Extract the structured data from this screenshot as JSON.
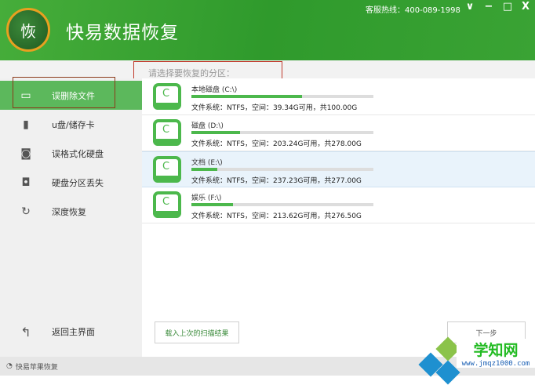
{
  "header": {
    "logo_char": "恢",
    "title": "快易数据恢复",
    "hotline": "客服热线：400-089-1998",
    "controls": {
      "dropdown": "∨",
      "minimize": "−",
      "maximize": "□",
      "close": "X"
    }
  },
  "prompt": "请选择要恢复的分区：",
  "sidebar": {
    "items": [
      {
        "label": "误删除文件",
        "icon": "folder-icon"
      },
      {
        "label": "u盘/储存卡",
        "icon": "usb-icon"
      },
      {
        "label": "误格式化硬盘",
        "icon": "hard-disk-icon"
      },
      {
        "label": "硬盘分区丢失",
        "icon": "partition-icon"
      },
      {
        "label": "深度恢复",
        "icon": "deep-scan-icon"
      }
    ],
    "back_label": "返回主界面"
  },
  "partitions": [
    {
      "name": "本地磁盘 (C:\\)",
      "info": "文件系统：NTFS，空间：39.34G可用，共100.00G",
      "used_pct": 60.7
    },
    {
      "name": "磁盘 (D:\\)",
      "info": "文件系统：NTFS，空间：203.24G可用，共278.00G",
      "used_pct": 26.9
    },
    {
      "name": "文档 (E:\\)",
      "info": "文件系统：NTFS，空间：237.23G可用，共277.00G",
      "used_pct": 14.4
    },
    {
      "name": "娱乐 (F:\\)",
      "info": "文件系统：NTFS，空间：213.62G可用，共276.50G",
      "used_pct": 22.7
    }
  ],
  "buttons": {
    "load_last": "载入上次的扫描结果",
    "next": "下一步"
  },
  "statusbar": {
    "label": "快易苹果恢复"
  },
  "watermark": {
    "name": "学知网",
    "url": "www.jmqz1000.com"
  },
  "colors": {
    "brand_green": "#3aa334",
    "accent_green": "#4cb84c",
    "selected_row": "#e9f3fb"
  }
}
